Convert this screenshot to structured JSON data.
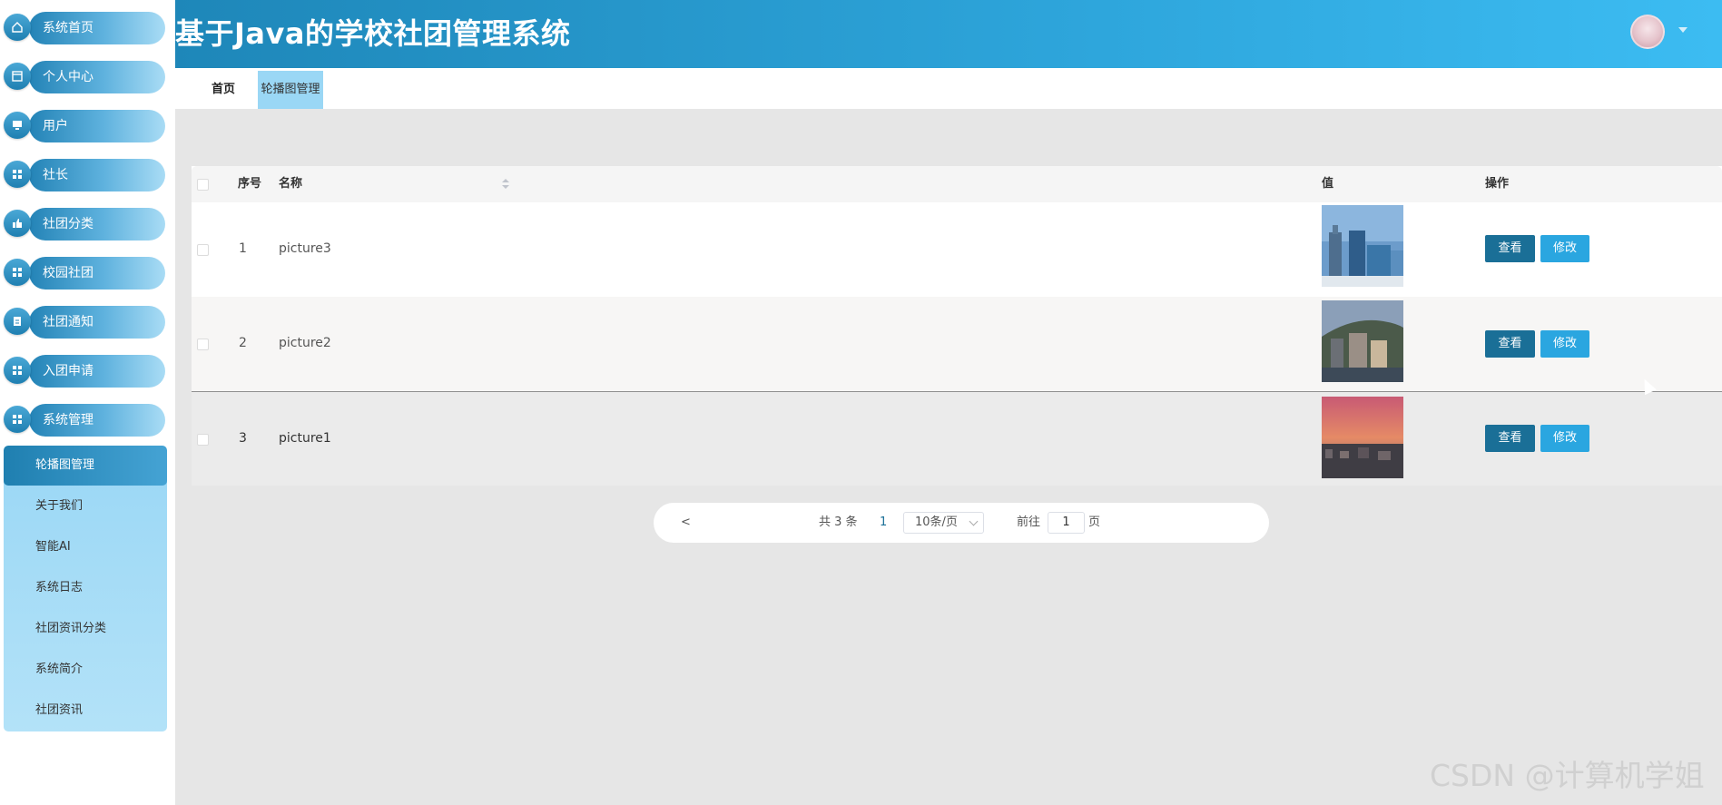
{
  "app": {
    "title": "基于Java的学校社团管理系统"
  },
  "sidebar": {
    "items": [
      {
        "label": "系统首页",
        "icon": "home-icon"
      },
      {
        "label": "个人中心",
        "icon": "window-icon"
      },
      {
        "label": "用户",
        "icon": "monitor-icon"
      },
      {
        "label": "社长",
        "icon": "grid-icon"
      },
      {
        "label": "社团分类",
        "icon": "thumb-icon"
      },
      {
        "label": "校园社团",
        "icon": "grid-icon"
      },
      {
        "label": "社团通知",
        "icon": "clipboard-icon"
      },
      {
        "label": "入团申请",
        "icon": "grid-icon"
      },
      {
        "label": "系统管理",
        "icon": "grid-icon"
      }
    ],
    "submenu": [
      {
        "label": "轮播图管理"
      },
      {
        "label": "关于我们"
      },
      {
        "label": "智能AI"
      },
      {
        "label": "系统日志"
      },
      {
        "label": "社团资讯分类"
      },
      {
        "label": "系统简介"
      },
      {
        "label": "社团资讯"
      }
    ]
  },
  "tabs": {
    "home": "首页",
    "active": "轮播图管理"
  },
  "table": {
    "headers": {
      "index": "序号",
      "name": "名称",
      "value": "值",
      "ops": "操作"
    },
    "rows": [
      {
        "index": "1",
        "name": "picture3"
      },
      {
        "index": "2",
        "name": "picture2"
      },
      {
        "index": "3",
        "name": "picture1"
      }
    ],
    "view_label": "查看",
    "edit_label": "修改"
  },
  "pagination": {
    "prev": "<",
    "total": "共 3 条",
    "page": "1",
    "page_size": "10条/页",
    "goto": "前往",
    "goto_value": "1",
    "page_unit": "页"
  },
  "watermark": "CSDN @计算机学姐",
  "colors": {
    "accent": "#2aa6e0",
    "accent_dark": "#1a6f97",
    "header": "#2ea6dc"
  }
}
